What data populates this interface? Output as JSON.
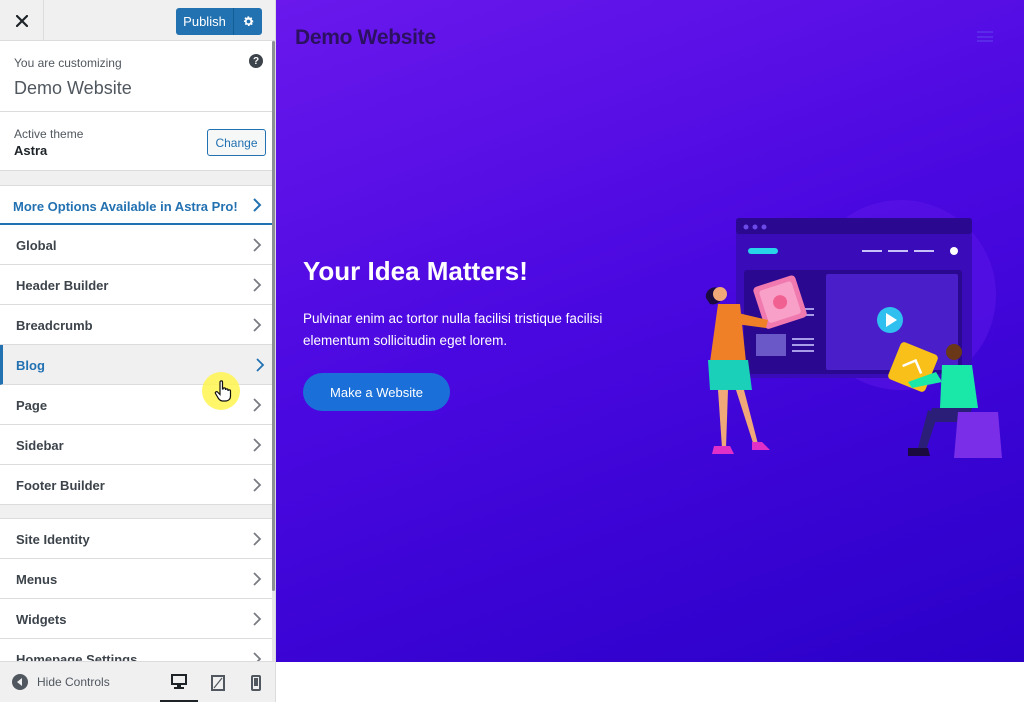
{
  "topbar": {
    "publish_label": "Publish"
  },
  "customizing": {
    "label": "You are customizing",
    "site_name": "Demo Website",
    "help": "?"
  },
  "theme": {
    "label": "Active theme",
    "name": "Astra",
    "change_label": "Change"
  },
  "pro": {
    "label": "More Options Available in Astra Pro!"
  },
  "menu_group1": [
    "Global",
    "Header Builder",
    "Breadcrumb",
    "Blog",
    "Page",
    "Sidebar",
    "Footer Builder"
  ],
  "menu_group2": [
    "Site Identity",
    "Menus",
    "Widgets",
    "Homepage Settings"
  ],
  "active_item": "Blog",
  "footer": {
    "hide_label": "Hide Controls"
  },
  "preview": {
    "site_title": "Demo Website",
    "hero_title": "Your Idea Matters!",
    "hero_text": "Pulvinar enim ac tortor nulla facilisi tristique facilisi elementum sollicitudin eget lorem.",
    "cta_label": "Make a Website"
  },
  "colors": {
    "accent": "#2271b1",
    "preview_bg": "#4a08e0",
    "cta": "#1a6fd8"
  },
  "icons": [
    "close-icon",
    "gear-icon",
    "help-icon",
    "chevron-right-icon",
    "arrow-left-circle-icon",
    "desktop-icon",
    "tablet-icon",
    "mobile-icon",
    "hamburger-icon",
    "hand-cursor-icon"
  ]
}
